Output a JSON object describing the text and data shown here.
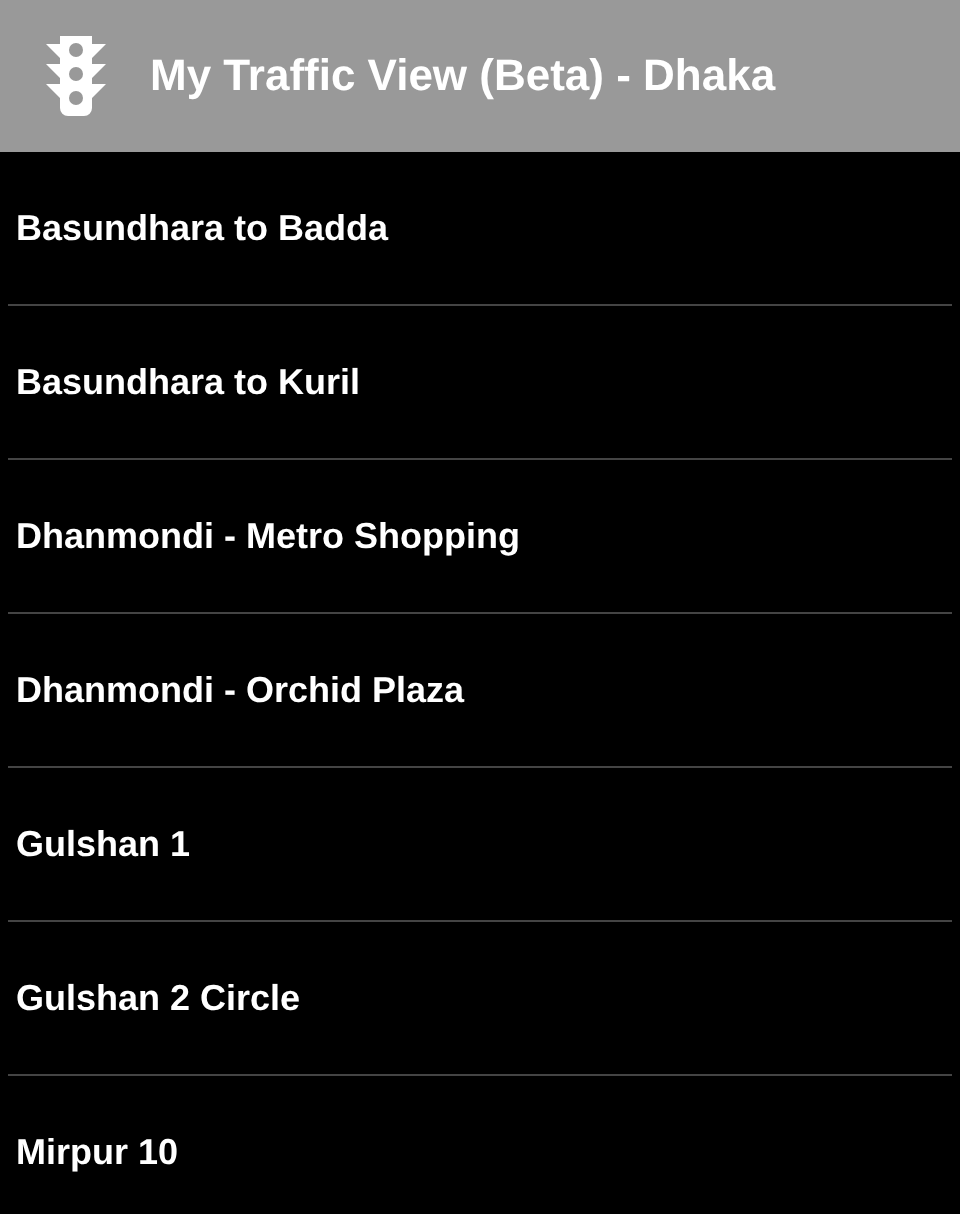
{
  "app_bar": {
    "title": "My Traffic View (Beta) - Dhaka"
  },
  "list": {
    "items": [
      {
        "label": "Basundhara to Badda"
      },
      {
        "label": "Basundhara to Kuril"
      },
      {
        "label": "Dhanmondi - Metro Shopping"
      },
      {
        "label": "Dhanmondi - Orchid Plaza"
      },
      {
        "label": "Gulshan 1"
      },
      {
        "label": "Gulshan 2 Circle"
      },
      {
        "label": "Mirpur 10"
      }
    ]
  }
}
